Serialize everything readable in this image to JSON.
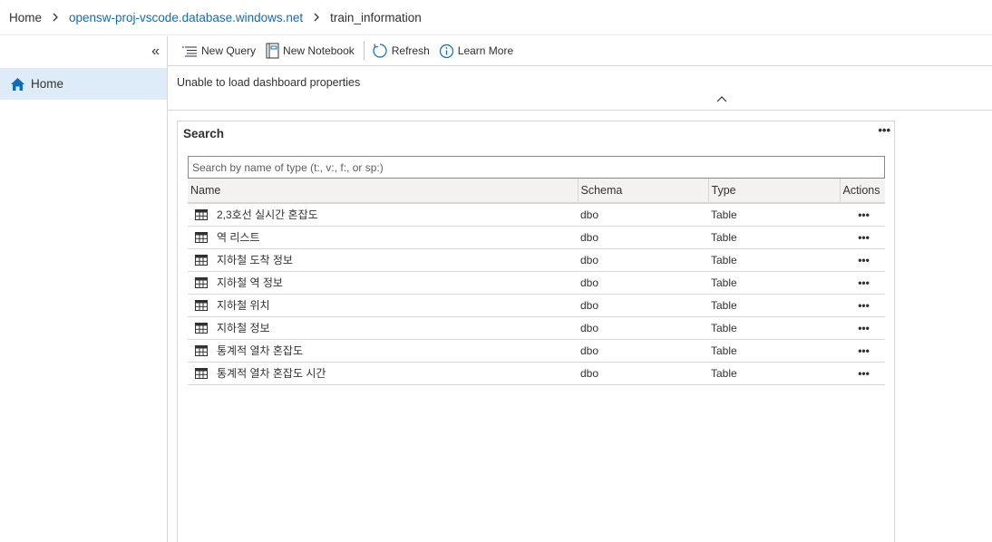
{
  "breadcrumb": {
    "home": "Home",
    "server": "opensw-proj-vscode.database.windows.net",
    "database": "train_information"
  },
  "sidebar": {
    "collapse_glyph": "«",
    "items": [
      {
        "label": "Home",
        "icon": "home-icon",
        "active": true
      }
    ]
  },
  "toolbar": {
    "new_query": "New Query",
    "new_notebook": "New Notebook",
    "refresh": "Refresh",
    "learn_more": "Learn More"
  },
  "dashboard": {
    "message": "Unable to load dashboard properties"
  },
  "search_widget": {
    "title": "Search",
    "more": "•••",
    "placeholder": "Search by name of type (t:, v:, f:, or sp:)",
    "columns": [
      "Name",
      "Schema",
      "Type",
      "Actions"
    ],
    "rows": [
      {
        "name": "2,3호선 실시간 혼잡도",
        "schema": "dbo",
        "type": "Table",
        "actions": "•••"
      },
      {
        "name": "역 리스트",
        "schema": "dbo",
        "type": "Table",
        "actions": "•••"
      },
      {
        "name": "지하철 도착 정보",
        "schema": "dbo",
        "type": "Table",
        "actions": "•••"
      },
      {
        "name": "지하철 역 정보",
        "schema": "dbo",
        "type": "Table",
        "actions": "•••"
      },
      {
        "name": "지하철 위치",
        "schema": "dbo",
        "type": "Table",
        "actions": "•••"
      },
      {
        "name": "지하철 정보",
        "schema": "dbo",
        "type": "Table",
        "actions": "•••"
      },
      {
        "name": "통계적 열차 혼잡도",
        "schema": "dbo",
        "type": "Table",
        "actions": "•••"
      },
      {
        "name": "통계적 열차 혼잡도 시간",
        "schema": "dbo",
        "type": "Table",
        "actions": "•••"
      }
    ]
  },
  "colors": {
    "accent": "#0f6cbd",
    "selected": "#deecf9",
    "border": "#d6d6d6"
  }
}
